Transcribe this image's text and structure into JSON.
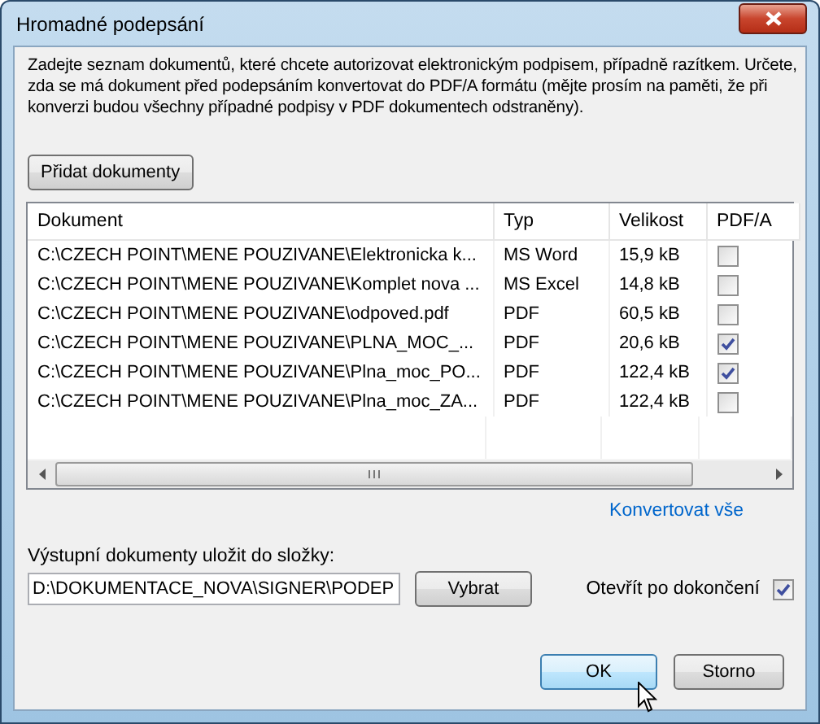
{
  "window": {
    "title": "Hromadné podepsání"
  },
  "intro": "Zadejte seznam dokumentů, které chcete autorizovat elektronickým podpisem, případně razítkem. Určete, zda se má dokument před podepsáním konvertovat do PDF/A formátu (mějte prosím na paměti, že při konverzi budou všechny případné podpisy v PDF dokumentech odstraněny).",
  "add_button": "Přidat dokumenty",
  "table": {
    "columns": [
      "Dokument",
      "Typ",
      "Velikost",
      "PDF/A"
    ],
    "rows": [
      {
        "document": "C:\\CZECH POINT\\MENE POUZIVANE\\Elektronicka k...",
        "type": "MS Word",
        "size": "15,9 kB",
        "pdfa": false
      },
      {
        "document": "C:\\CZECH POINT\\MENE POUZIVANE\\Komplet nova ...",
        "type": "MS Excel",
        "size": "14,8 kB",
        "pdfa": false
      },
      {
        "document": "C:\\CZECH POINT\\MENE POUZIVANE\\odpoved.pdf",
        "type": "PDF",
        "size": "60,5 kB",
        "pdfa": false
      },
      {
        "document": "C:\\CZECH POINT\\MENE POUZIVANE\\PLNA_MOC_...",
        "type": "PDF",
        "size": "20,6 kB",
        "pdfa": true
      },
      {
        "document": "C:\\CZECH POINT\\MENE POUZIVANE\\Plna_moc_PO...",
        "type": "PDF",
        "size": "122,4 kB",
        "pdfa": true
      },
      {
        "document": "C:\\CZECH POINT\\MENE POUZIVANE\\Plna_moc_ZA...",
        "type": "PDF",
        "size": "122,4 kB",
        "pdfa": false
      }
    ]
  },
  "convert_all_link": "Konvertovat vše",
  "output": {
    "label": "Výstupní dokumenty uložit do složky:",
    "value": "D:\\DOKUMENTACE_NOVA\\SIGNER\\PODEP",
    "browse_button": "Vybrat",
    "open_after_label": "Otevřít po dokončení",
    "open_after": true
  },
  "buttons": [
    "OK",
    "Storno"
  ]
}
